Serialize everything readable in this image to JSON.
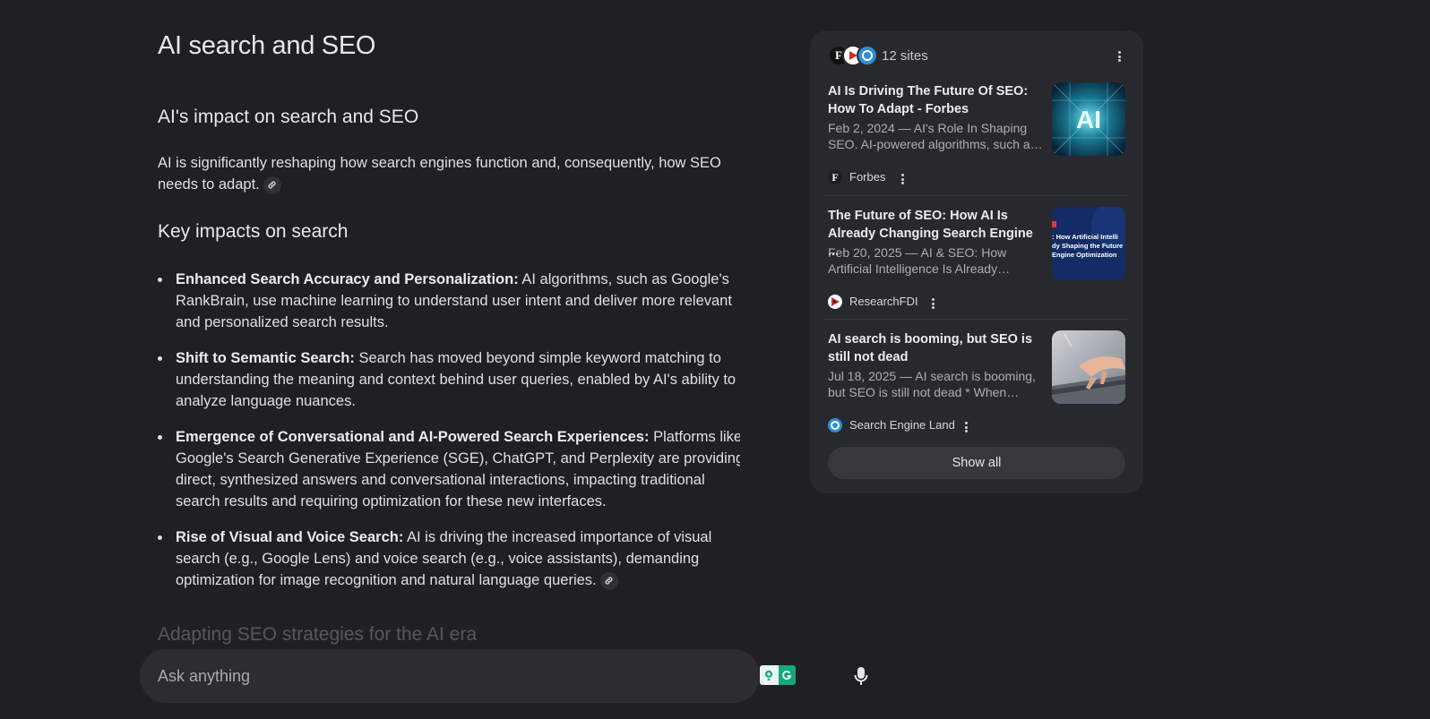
{
  "answer": {
    "title": "AI search and SEO",
    "section1_heading": "AI's impact on search and SEO",
    "intro": "AI is significantly reshaping how search engines function and, consequently, how SEO needs to adapt.",
    "section2_heading": "Key impacts on search",
    "bullets": [
      {
        "bold": "Enhanced Search Accuracy and Personalization:",
        "text": " AI algorithms, such as Google's RankBrain, use machine learning to understand user intent and deliver more relevant and personalized search results."
      },
      {
        "bold": "Shift to Semantic Search:",
        "text": " Search has moved beyond simple keyword matching to understanding the meaning and context behind user queries, enabled by AI's ability to analyze language nuances."
      },
      {
        "bold": "Emergence of Conversational and AI-Powered Search Experiences:",
        "text": " Platforms like Google's Search Generative Experience (SGE), ChatGPT, and Perplexity are providing direct, synthesized answers and conversational interactions, impacting traditional search results and requiring optimization for these new interfaces."
      },
      {
        "bold": "Rise of Visual and Voice Search:",
        "text": " AI is driving the increased importance of visual search (e.g., Google Lens) and voice search (e.g., voice assistants), demanding optimization for image recognition and natural language queries."
      }
    ],
    "next_heading": "Adapting SEO strategies for the AI era"
  },
  "ask_bar": {
    "placeholder": "Ask anything"
  },
  "sources_panel": {
    "count_label": "12 sites",
    "show_all_label": "Show all",
    "sources": [
      {
        "title": "AI Is Driving The Future Of SEO: How To Adapt - Forbes",
        "snippet": "Feb 2, 2024 — AI's Role In Shaping SEO. AI-powered algorithms, such as Google's...",
        "site": "Forbes",
        "favicon_letter": "F"
      },
      {
        "title": "The Future of SEO: How AI Is Already Changing Search Engine ...",
        "snippet": "Feb 20, 2025 — AI & SEO: How Artificial Intelligence Is Already Shaping the Future...",
        "site": "ResearchFDI",
        "thumb_text": ": How Artificial Intelli dy Shaping the Future Engine Optimization"
      },
      {
        "title": "AI search is booming, but SEO is still not dead",
        "snippet": "Jul 18, 2025 — AI search is booming, but SEO is still not dead * When LLMs...",
        "site": "Search Engine Land"
      }
    ],
    "thumb1_text": "AI"
  },
  "colors": {
    "background": "#1f1f24",
    "panel": "#28292e",
    "ask_bar": "#2c2c31",
    "grammarly_green": "#15a878"
  }
}
